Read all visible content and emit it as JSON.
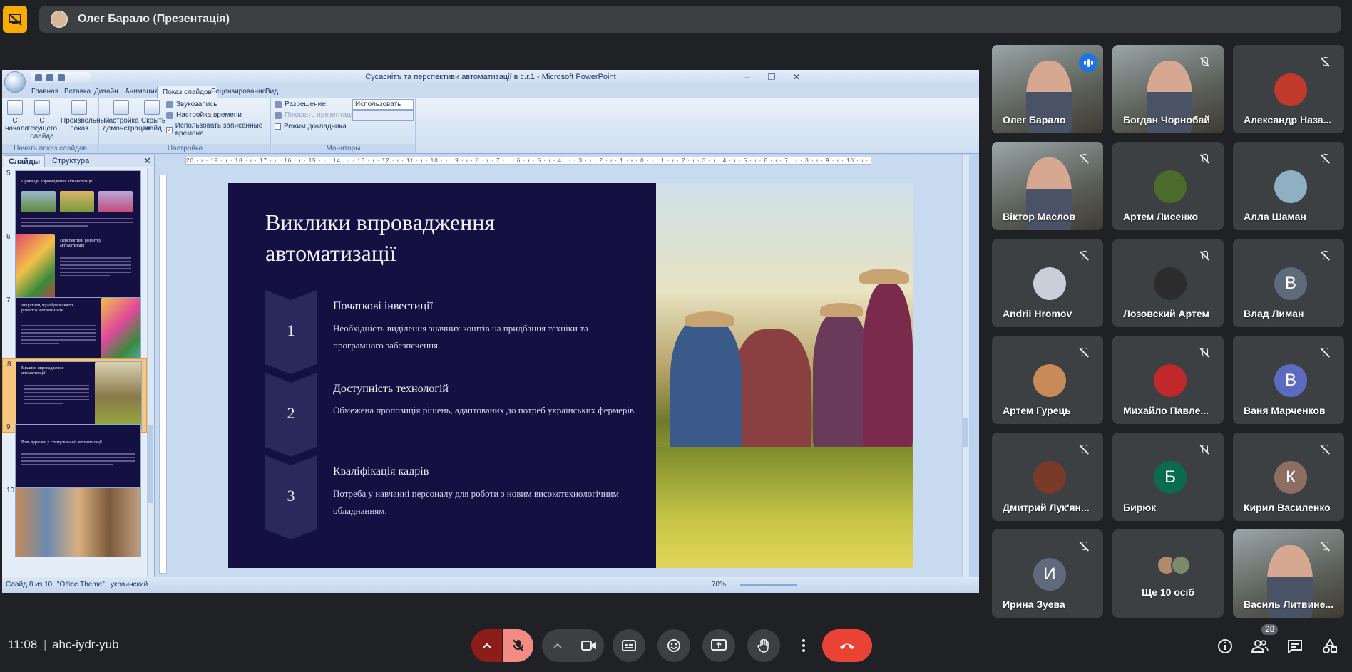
{
  "meet": {
    "presenter_label": "Олег Барало (Презентація)",
    "clock": "11:08",
    "meeting_code": "ahc-iydr-yub",
    "participant_count": "28",
    "colors": {
      "background": "#202124",
      "bar": "#3c4043",
      "accent_present": "#f9ab00",
      "end_call": "#ea4335",
      "speaker_ring": "#8ab4f8"
    }
  },
  "ppt": {
    "window_title": "Сусаснітъ та перспективи автоматизації в с.г.1 - Microsoft PowerPoint",
    "tabs": [
      "Главная",
      "Вставка",
      "Дизайн",
      "Анимация",
      "Показ слайдов",
      "Рецензирование",
      "Вид"
    ],
    "active_tab": "Показ слайдов",
    "ribbon": {
      "btn_from_start": "С начала",
      "btn_from_current": "С текущего слайда",
      "btn_custom": "Произвольный показ",
      "group_start": "Начать показ слайдов",
      "btn_setup": "Настройка демонстрации",
      "btn_hide": "Скрыть слайд",
      "record_narration": "Звукозапись",
      "rehearse_timings": "Настройка времени",
      "use_timings": "Использовать записанные времена",
      "group_setup": "Настройка",
      "resolution_label": "Разрешение:",
      "resolution_value": "Использовать теку...",
      "show_on_label": "Показать презентацию на:",
      "presenter_view": "Режим докладчика",
      "group_monitors": "Мониторы"
    },
    "pane_tab_slides": "Слайды",
    "pane_tab_outline": "Структура",
    "ruler_text": "20 · ı · 19 · ı · 18 · ı · 17 · ı · 16 · ı · 15 · ı · 14 · ı · 13 · ı · 12 · ı · 11 · ı · 10 · ı · 9 · ı · 8 · ı · 7 · ı · 6 · ı · 5 · ı · 4 · ı · 3 · ı · 2 · ı · 1 · ı · 0 · ı · 1 · ı · 2 · ı · 3 · ı · 4 · ı · 5 · ı · 6 · ı · 7 · ı · 8 · ı · 9 · ı · 10 · ı · 11 · ı · 12 · ı · 13 · ı · 14 · ı · 15 · ı · 16 · ı · 17 · ı · 18 · ı · 19 · ı · 20",
    "thumbnails": [
      {
        "num": "5",
        "title": "Приклади впровадження автоматизації"
      },
      {
        "num": "6",
        "title": "Перспективи розвитку автоматизації"
      },
      {
        "num": "7",
        "title": "Ініціативи, що обумовлюють розвиток автоматизації"
      },
      {
        "num": "8",
        "title": "Виклики впровадження автоматизації"
      },
      {
        "num": "9",
        "title": "Роль держави у стимулюванні автоматизації"
      },
      {
        "num": "10",
        "title": ""
      }
    ],
    "selected_thumb": "8",
    "status": {
      "slide_of": "Слайд 8 из 10",
      "theme": "\"Office Theme\"",
      "language": "украинский",
      "zoom": "70%"
    }
  },
  "slide": {
    "title": "Виклики впровадження автоматизації",
    "steps": [
      {
        "num": "1",
        "head": "Початкові інвестиції",
        "text": "Необхідність виділення значних коштів на придбання техніки та програмного забезпечення."
      },
      {
        "num": "2",
        "head": "Доступність технологій",
        "text": "Обмежена пропозиція рішень, адаптованих до потреб українських фермерів."
      },
      {
        "num": "3",
        "head": "Кваліфікація кадрів",
        "text": "Потреба у навчанні персоналу для роботи з новим високотехнологічним обладнанням."
      }
    ]
  },
  "participants": [
    {
      "name": "Олег Барало",
      "kind": "video",
      "speaking": true
    },
    {
      "name": "Богдан Чорнобай",
      "kind": "video"
    },
    {
      "name": "Александр Наза...",
      "kind": "avatar-photo",
      "color": "#c0392b"
    },
    {
      "name": "Віктор Маслов",
      "kind": "video"
    },
    {
      "name": "Артем Лисенко",
      "kind": "avatar-photo",
      "color": "#4a6b2a"
    },
    {
      "name": "Алла Шаман",
      "kind": "avatar-photo",
      "color": "#8fb0c2"
    },
    {
      "name": "Andrii Hromov",
      "kind": "avatar-photo",
      "color": "#c9ced8"
    },
    {
      "name": "Лозовский Артем",
      "kind": "avatar-photo",
      "color": "#2c2c2c"
    },
    {
      "name": "Влад Лиман",
      "kind": "letter",
      "letter": "В",
      "color": "#5f6b7a"
    },
    {
      "name": "Артем Гурець",
      "kind": "avatar-photo",
      "color": "#c98a5a"
    },
    {
      "name": "Михайло Павле...",
      "kind": "avatar-photo",
      "color": "#c0282b"
    },
    {
      "name": "Ваня Марченков",
      "kind": "letter",
      "letter": "В",
      "color": "#5c6bc0"
    },
    {
      "name": "Дмитрий Лук'ян...",
      "kind": "avatar-photo",
      "color": "#7a3a2a"
    },
    {
      "name": "Бирюк",
      "kind": "letter",
      "letter": "Б",
      "color": "#0b6b4f"
    },
    {
      "name": "Кирил Василенко",
      "kind": "letter",
      "letter": "К",
      "color": "#8d6e63"
    },
    {
      "name": "Ирина Зуева",
      "kind": "letter",
      "letter": "И",
      "color": "#5f6b7a"
    },
    {
      "name": "Ще 10 осіб",
      "kind": "more"
    },
    {
      "name": "Василь Литвине...",
      "kind": "video"
    }
  ]
}
